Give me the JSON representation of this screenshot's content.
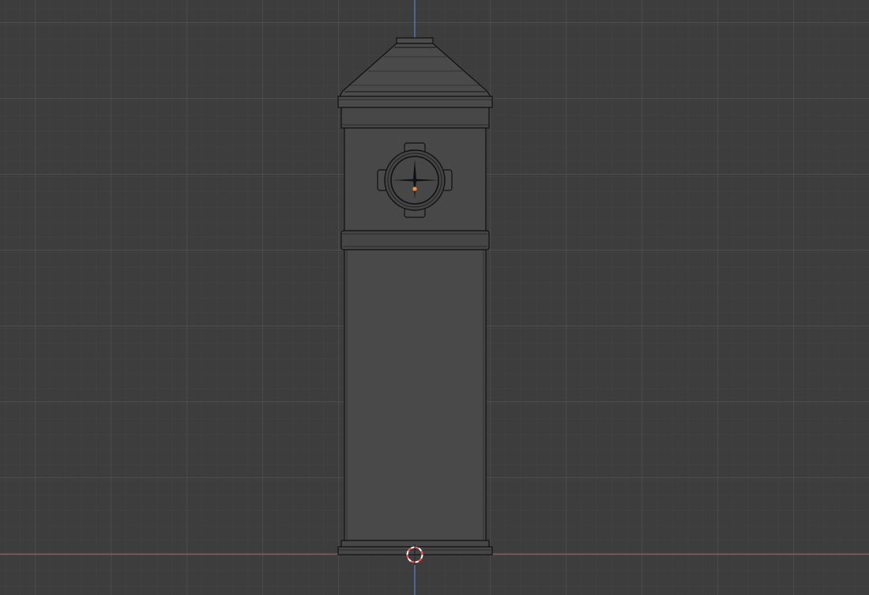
{
  "viewport": {
    "view": "3d-viewport-front-orthographic",
    "colors": {
      "background": "#3d3d3d",
      "grid_minor": "#464646",
      "grid_major": "#525252",
      "z_axis": "#5b7fd1",
      "x_axis": "#b24a4a",
      "mesh_fill": "#474747",
      "mesh_edge": "#0e0e0e",
      "origin_dot": "#ff8c30",
      "cursor_red": "#ff5a5a",
      "cursor_white": "#ffffff"
    }
  },
  "scene": {
    "object": "post-box-pillar-mesh",
    "selected": false
  }
}
